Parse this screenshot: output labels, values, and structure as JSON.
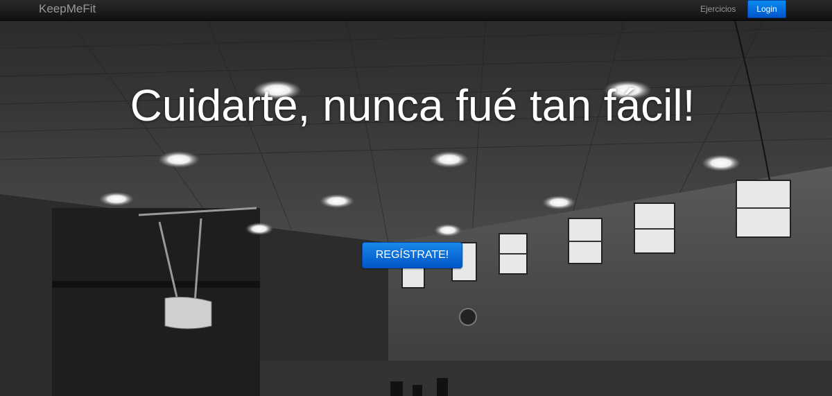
{
  "navbar": {
    "brand": "KeepMeFit",
    "links": [
      {
        "label": "Ejercicios"
      }
    ],
    "login_label": "Login"
  },
  "hero": {
    "headline": "Cuidarte, nunca fué tan fácil!",
    "cta_label": "REGÍSTRATE!"
  },
  "colors": {
    "accent": "#0066dd",
    "navbar_bg": "#1a1a1a",
    "headline": "#ffffff"
  }
}
